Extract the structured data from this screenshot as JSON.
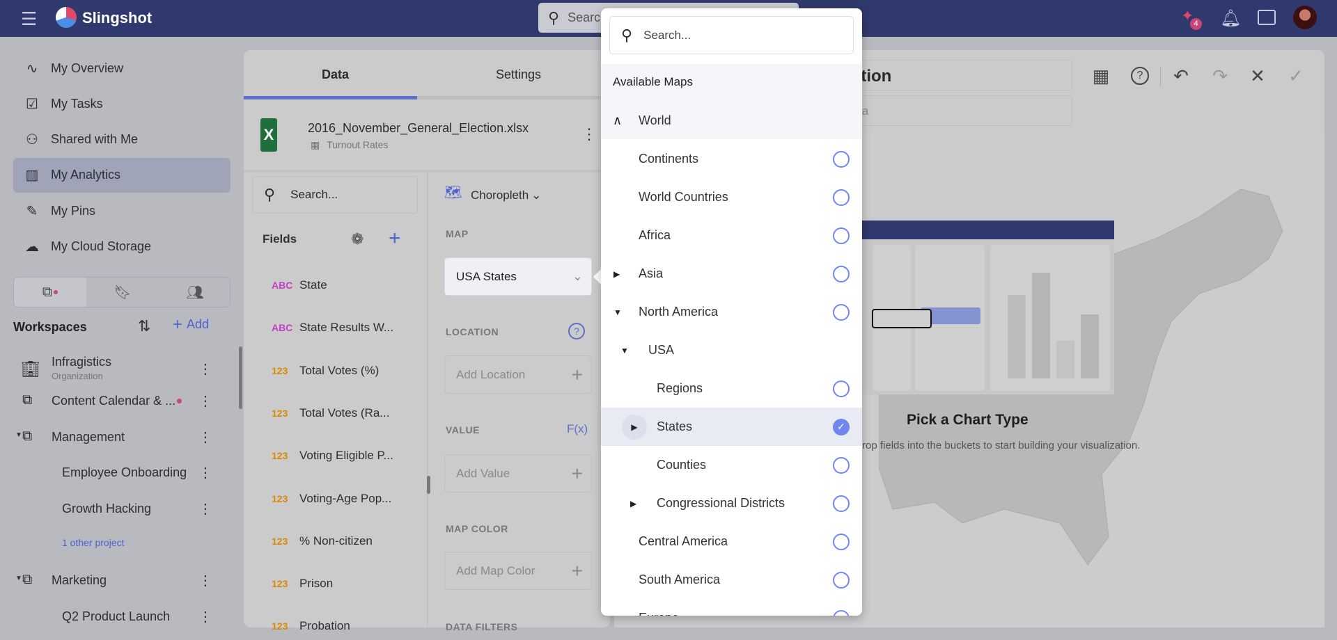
{
  "header": {
    "app_name": "Slingshot",
    "search_placeholder": "Search",
    "notification_count": "4",
    "brand_color": "#30396d"
  },
  "sidebar": {
    "nav": [
      {
        "label": "My Overview",
        "icon": "activity-icon"
      },
      {
        "label": "My Tasks",
        "icon": "clipboard-check-icon"
      },
      {
        "label": "Shared with Me",
        "icon": "user-check-icon"
      },
      {
        "label": "My Analytics",
        "icon": "bar-chart-icon",
        "selected": true
      },
      {
        "label": "My Pins",
        "icon": "pin-icon"
      },
      {
        "label": "My Cloud Storage",
        "icon": "cloud-icon"
      }
    ],
    "workspaces_title": "Workspaces",
    "add_label": "Add",
    "workspaces": [
      {
        "label": "Infragistics",
        "sub": "Organization"
      },
      {
        "label": "Content Calendar & ..."
      },
      {
        "label": "Management"
      },
      {
        "label": "Employee Onboarding"
      },
      {
        "label": "Growth Hacking"
      },
      {
        "label": "1 other project"
      },
      {
        "label": "Marketing"
      },
      {
        "label": "Q2 Product Launch"
      }
    ]
  },
  "editor": {
    "tabs": [
      "Data",
      "Settings"
    ],
    "file_name": "2016_November_General_Election.xlsx",
    "sheet_name": "Turnout Rates",
    "search_placeholder": "Search...",
    "fields_title": "Fields",
    "fields": [
      {
        "type": "ABC",
        "label": "State"
      },
      {
        "type": "ABC",
        "label": "State Results W..."
      },
      {
        "type": "123",
        "label": "Total Votes (%)"
      },
      {
        "type": "123",
        "label": "Total Votes (Ra..."
      },
      {
        "type": "123",
        "label": "Voting Eligible P..."
      },
      {
        "type": "123",
        "label": "Voting-Age Pop..."
      },
      {
        "type": "123",
        "label": "% Non-citizen"
      },
      {
        "type": "123",
        "label": "Prison"
      },
      {
        "type": "123",
        "label": "Probation"
      }
    ],
    "chart_type": "Choropleth",
    "map_label": "MAP",
    "map_value": "USA States",
    "location_label": "LOCATION",
    "location_placeholder": "Add Location",
    "value_label": "VALUE",
    "fx_label": "F(x)",
    "value_placeholder": "Add Value",
    "map_color_label": "MAP COLOR",
    "map_color_placeholder": "Add Map Color",
    "data_filters_label": "DATA FILTERS"
  },
  "preview": {
    "title_fragment": "ction",
    "subtitle_fragment": "ta",
    "heading": "Pick a Chart Type",
    "description": "rop fields into the buckets to start building your visualization."
  },
  "dropdown": {
    "search_placeholder": "Search...",
    "section_title": "Available Maps",
    "items": [
      {
        "label": "World",
        "level": 0,
        "expander": "collapse-up",
        "radio": false
      },
      {
        "label": "Continents",
        "level": 1,
        "radio": true
      },
      {
        "label": "World Countries",
        "level": 1,
        "radio": true
      },
      {
        "label": "Africa",
        "level": 1,
        "radio": true
      },
      {
        "label": "Asia",
        "level": 1,
        "expander": "right",
        "radio": true
      },
      {
        "label": "North America",
        "level": 1,
        "expander": "down",
        "radio": true
      },
      {
        "label": "USA",
        "level": 2,
        "expander": "down",
        "radio": false
      },
      {
        "label": "Regions",
        "level": 3,
        "radio": true
      },
      {
        "label": "States",
        "level": 3,
        "expander": "right",
        "radio": true,
        "selected": true
      },
      {
        "label": "Counties",
        "level": 3,
        "radio": true
      },
      {
        "label": "Congressional Districts",
        "level": 3,
        "expander": "right",
        "radio": true
      },
      {
        "label": "Central America",
        "level": 1,
        "radio": true
      },
      {
        "label": "South America",
        "level": 1,
        "radio": true
      },
      {
        "label": "Europe",
        "level": 1,
        "radio": true
      }
    ],
    "accent": "#6f86f0"
  }
}
